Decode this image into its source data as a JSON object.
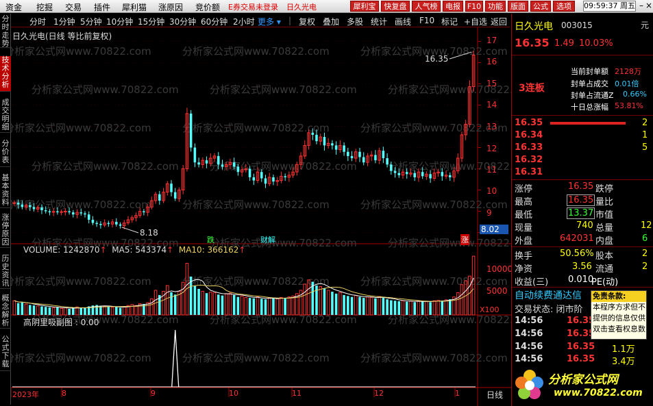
{
  "menubar": {
    "items": [
      "资金",
      "挖掘",
      "交易",
      "插件",
      "犀利猫",
      "涨原因",
      "竞价额"
    ],
    "login_status": "E券交易未登录",
    "stock_name": "日久光电",
    "toolbar_buttons": [
      "犀利宝",
      "快复盘",
      "人气榜",
      "电报",
      "F10",
      "功能",
      "版面",
      "公式",
      "选项"
    ],
    "clock": "09:59:37 周五"
  },
  "left_tabs": [
    "分时走势",
    "技术分析",
    "成交明细",
    "分价表",
    "基本资料",
    "涨停原因",
    "历史资讯",
    "概念解析",
    "公式下载"
  ],
  "period_bar": {
    "periods": [
      "分时",
      "1分钟",
      "5分钟",
      "10分钟",
      "15分钟",
      "30分钟",
      "60分钟",
      "2小时"
    ],
    "more": "更多",
    "tools": [
      "复权",
      "叠加",
      "多股",
      "统计",
      "画线",
      "F10",
      "标记",
      "+自选",
      "返回"
    ]
  },
  "chart_title": "日久光电(日线 等比前复权)",
  "watermark": "分析家公式网www.70822.com",
  "chart_data": {
    "type": "candlestick",
    "dates": [
      "2023-07-17",
      "2023-07-18",
      "2023-07-19",
      "2023-07-20",
      "2023-07-21",
      "2023-07-24",
      "2023-07-25",
      "2023-07-26",
      "2023-07-27",
      "2023-07-28",
      "2023-07-31",
      "2023-08-01",
      "2023-08-02",
      "2023-08-03",
      "2023-08-04",
      "2023-08-07",
      "2023-08-08",
      "2023-08-09",
      "2023-08-10",
      "2023-08-11",
      "2023-08-14",
      "2023-08-15",
      "2023-08-16",
      "2023-08-17",
      "2023-08-18",
      "2023-08-21",
      "2023-08-22",
      "2023-08-23",
      "2023-08-24",
      "2023-08-25",
      "2023-08-28",
      "2023-08-29",
      "2023-08-30",
      "2023-08-31",
      "2023-09-01",
      "2023-09-04",
      "2023-09-05",
      "2023-09-06",
      "2023-09-07",
      "2023-09-08",
      "2023-09-11",
      "2023-09-12",
      "2023-09-13",
      "2023-09-14",
      "2023-09-15",
      "2023-09-18",
      "2023-09-19",
      "2023-09-20",
      "2023-09-21",
      "2023-09-22",
      "2023-09-25",
      "2023-09-26",
      "2023-09-27",
      "2023-09-28",
      "2023-10-09",
      "2023-10-10",
      "2023-10-11",
      "2023-10-12",
      "2023-10-13",
      "2023-10-16",
      "2023-10-17",
      "2023-10-18",
      "2023-10-19",
      "2023-10-20",
      "2023-10-23",
      "2023-10-24",
      "2023-10-25",
      "2023-10-26",
      "2023-10-27",
      "2023-10-30",
      "2023-10-31",
      "2023-11-01",
      "2023-11-02",
      "2023-11-03",
      "2023-11-06",
      "2023-11-07",
      "2023-11-08",
      "2023-11-09",
      "2023-11-10",
      "2023-11-13",
      "2023-11-14",
      "2023-11-15",
      "2023-11-16",
      "2023-11-17",
      "2023-11-20",
      "2023-11-21",
      "2023-11-22",
      "2023-11-23",
      "2023-11-24",
      "2023-11-27",
      "2023-11-28",
      "2023-11-29",
      "2023-11-30",
      "2023-12-01",
      "2023-12-04",
      "2023-12-05",
      "2023-12-06",
      "2023-12-07",
      "2023-12-08",
      "2023-12-11",
      "2023-12-12",
      "2023-12-13",
      "2023-12-14",
      "2023-12-15",
      "2023-12-18",
      "2023-12-19",
      "2023-12-20",
      "2023-12-21",
      "2023-12-22",
      "2023-12-25",
      "2023-12-26",
      "2023-12-27",
      "2023-12-28",
      "2023-12-29",
      "2024-01-02",
      "2024-01-03",
      "2024-01-04",
      "2024-01-05"
    ],
    "close": [
      9.4,
      9.32,
      9.2,
      9.28,
      9.2,
      9.1,
      9.18,
      9.05,
      9.0,
      8.95,
      9.0,
      8.95,
      8.98,
      9.0,
      8.95,
      8.85,
      8.95,
      8.9,
      8.85,
      8.6,
      8.45,
      8.4,
      8.35,
      8.45,
      8.4,
      8.5,
      8.38,
      8.32,
      8.45,
      8.6,
      8.7,
      8.8,
      9.0,
      8.95,
      9.2,
      9.5,
      9.8,
      9.5,
      9.9,
      10.3,
      9.9,
      9.6,
      10.0,
      11.0,
      13.6,
      12.0,
      11.3,
      11.2,
      11.4,
      11.25,
      11.5,
      11.6,
      11.2,
      11.1,
      11.2,
      11.3,
      11.1,
      10.85,
      10.95,
      11.0,
      10.6,
      10.45,
      10.85,
      10.55,
      10.3,
      10.6,
      10.4,
      10.45,
      10.65,
      10.6,
      10.7,
      10.85,
      11.2,
      11.6,
      12.1,
      12.7,
      12.6,
      12.3,
      12.5,
      12.1,
      12.2,
      12.1,
      11.9,
      12.1,
      11.8,
      11.6,
      11.5,
      11.8,
      11.55,
      11.3,
      11.6,
      11.65,
      11.4,
      11.85,
      11.5,
      11.2,
      10.9,
      10.8,
      10.7,
      10.85,
      10.75,
      10.8,
      10.6,
      10.85,
      10.65,
      10.75,
      10.55,
      10.8,
      10.85,
      10.65,
      10.7,
      10.6,
      10.9,
      11.5,
      12.6,
      13.1,
      14.87,
      16.35
    ],
    "volume": [
      300000,
      250000,
      260000,
      230000,
      210000,
      200000,
      190000,
      180000,
      170000,
      160000,
      150000,
      160000,
      140000,
      150000,
      130000,
      140000,
      170000,
      150000,
      160000,
      180000,
      200000,
      210000,
      190000,
      180000,
      170000,
      160000,
      170000,
      150000,
      180000,
      200000,
      220000,
      200000,
      240000,
      230000,
      260000,
      340000,
      520000,
      420000,
      500000,
      620000,
      480000,
      430000,
      500000,
      690000,
      1090000,
      810000,
      610000,
      550000,
      500000,
      460000,
      480000,
      470000,
      430000,
      410000,
      450000,
      460000,
      420000,
      380000,
      400000,
      370000,
      360000,
      350000,
      380000,
      340000,
      330000,
      360000,
      350000,
      340000,
      370000,
      360000,
      380000,
      400000,
      450000,
      520000,
      650000,
      740000,
      700000,
      620000,
      600000,
      560000,
      520000,
      490000,
      450000,
      470000,
      420000,
      400000,
      380000,
      410000,
      380000,
      360000,
      380000,
      370000,
      350000,
      390000,
      360000,
      330000,
      310000,
      300000,
      290000,
      300000,
      280000,
      290000,
      270000,
      300000,
      280000,
      290000,
      270000,
      300000,
      310000,
      300000,
      320000,
      330000,
      380000,
      470000,
      640000,
      720000,
      820000,
      1240000
    ],
    "price_ticks": [
      8,
      9,
      10,
      11,
      12,
      13,
      14,
      15,
      16,
      17
    ],
    "annotations": {
      "high": "16.35",
      "low": "8.18",
      "last": "8.02"
    },
    "markers": [
      "跌",
      "财解",
      "涨"
    ],
    "volume_indicator": {
      "name": "VOLUME",
      "value": "1242870",
      "ma5_label": "MA5",
      "ma5": "543374",
      "ma10_label": "MA10",
      "ma10": "366162"
    },
    "volume_ticks": [
      "10000",
      "5000"
    ],
    "volume_unit": "X100",
    "signal_indicator": {
      "name": "高阴里吸副图",
      "value": "0.00"
    },
    "month_labels": [
      "2023年",
      "8",
      "9",
      "10",
      "11",
      "12",
      "1"
    ],
    "period_label": "日线"
  },
  "quote": {
    "name": "日久光电",
    "code": "003015",
    "price": "16.35",
    "change": "1.49",
    "pct": "10.03%",
    "streak": "3连板",
    "seal": [
      {
        "label": "当前封单额",
        "value": "2128万"
      },
      {
        "label": "封单占成交",
        "value": "0.01倍"
      },
      {
        "label": "封单占流通Z",
        "value": "0.66%"
      },
      {
        "label": "十日总涨幅",
        "value": "53.81%"
      }
    ],
    "bids": [
      {
        "price": "16.35",
        "vol": "2"
      },
      {
        "price": "16.34",
        "vol": "1"
      },
      {
        "price": "16.33",
        "vol": "5"
      },
      {
        "price": "16.32",
        "vol": ""
      },
      {
        "price": "16.31",
        "vol": ""
      }
    ],
    "stats": [
      {
        "l1": "涨停",
        "v1": "16.35",
        "l2": "跌停",
        "v2": ""
      },
      {
        "l1": "最高",
        "v1": "16.35",
        "l2": "量比",
        "v2": ""
      },
      {
        "l1": "最低",
        "v1": "13.37",
        "l2": "市值",
        "v2": ""
      },
      {
        "l1": "现量",
        "v1": "740",
        "l2": "总量",
        "v2": "12"
      },
      {
        "l1": "外盘",
        "v1": "642031",
        "l2": "内盘",
        "v2": "6"
      }
    ],
    "stats2": [
      {
        "l1": "换手",
        "v1": "50.56%",
        "l2": "股本",
        "v2": "2"
      },
      {
        "l1": "净资",
        "v1": "3.56",
        "l2": "流通",
        "v2": "2"
      },
      {
        "l1": "收益(三)",
        "v1": "0.010",
        "l2": "PE(动)",
        "v2": ""
      }
    ],
    "renew": "自动续费通达信",
    "trade_status": "交易状态: 闭市阶",
    "ticks": [
      {
        "time": "14:56",
        "price": "16.35",
        "vol": ""
      },
      {
        "time": "14:56",
        "price": "16.35",
        "vol": ""
      },
      {
        "time": "14:56",
        "price": "16.35",
        "vol": "1.1万"
      },
      {
        "time": "14:56",
        "price": "16.35",
        "vol": "3.4万"
      }
    ]
  },
  "disclaimer": {
    "title": "免责条款:",
    "lines": [
      "本程序方求但不",
      "提供的信息仅供",
      "双击查看权息数"
    ]
  },
  "logo": {
    "text": "分析家公式网",
    "url": "www.70822.com"
  },
  "colors": {
    "up": "#ff3232",
    "down": "#54ffff",
    "accent": "#ff3232",
    "volume_ma5": "#ffffff",
    "volume_ma10": "#e8d060"
  }
}
